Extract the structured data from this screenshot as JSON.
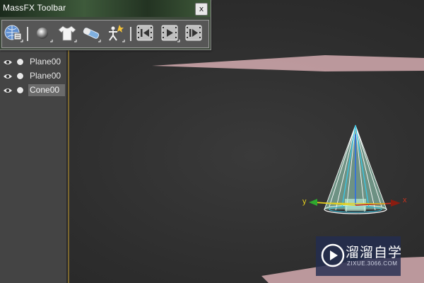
{
  "toolbar": {
    "title": "MassFX Toolbar",
    "close_label": "x",
    "tools": [
      {
        "icon": "world-parameters-icon"
      },
      {
        "icon": "rigid-body-icon"
      },
      {
        "icon": "mcloth-icon"
      },
      {
        "icon": "constraint-icon"
      },
      {
        "icon": "ragdoll-icon"
      },
      {
        "icon": "reset-simulation-icon"
      },
      {
        "icon": "play-simulation-icon"
      },
      {
        "icon": "step-simulation-icon"
      }
    ]
  },
  "explorer": {
    "items": [
      {
        "label": "Plane00",
        "selected": false
      },
      {
        "label": "Plane00",
        "selected": false
      },
      {
        "label": "Cone00",
        "selected": true
      }
    ]
  },
  "viewport": {
    "gizmo": {
      "x_label": "x",
      "y_label": "y"
    }
  },
  "watermark": {
    "title": "溜溜自学",
    "url": "ZIXUE.3066.COM"
  },
  "colors": {
    "viewport_bg": "#2f2f2f",
    "plane": "#c8a2a6",
    "cone_fill": "#9fe0c7",
    "toolbar_bg": "#3f4a3d",
    "gizmo_x": "#c8321e",
    "gizmo_y": "#2ea82e",
    "gizmo_z": "#2c6ee8"
  }
}
